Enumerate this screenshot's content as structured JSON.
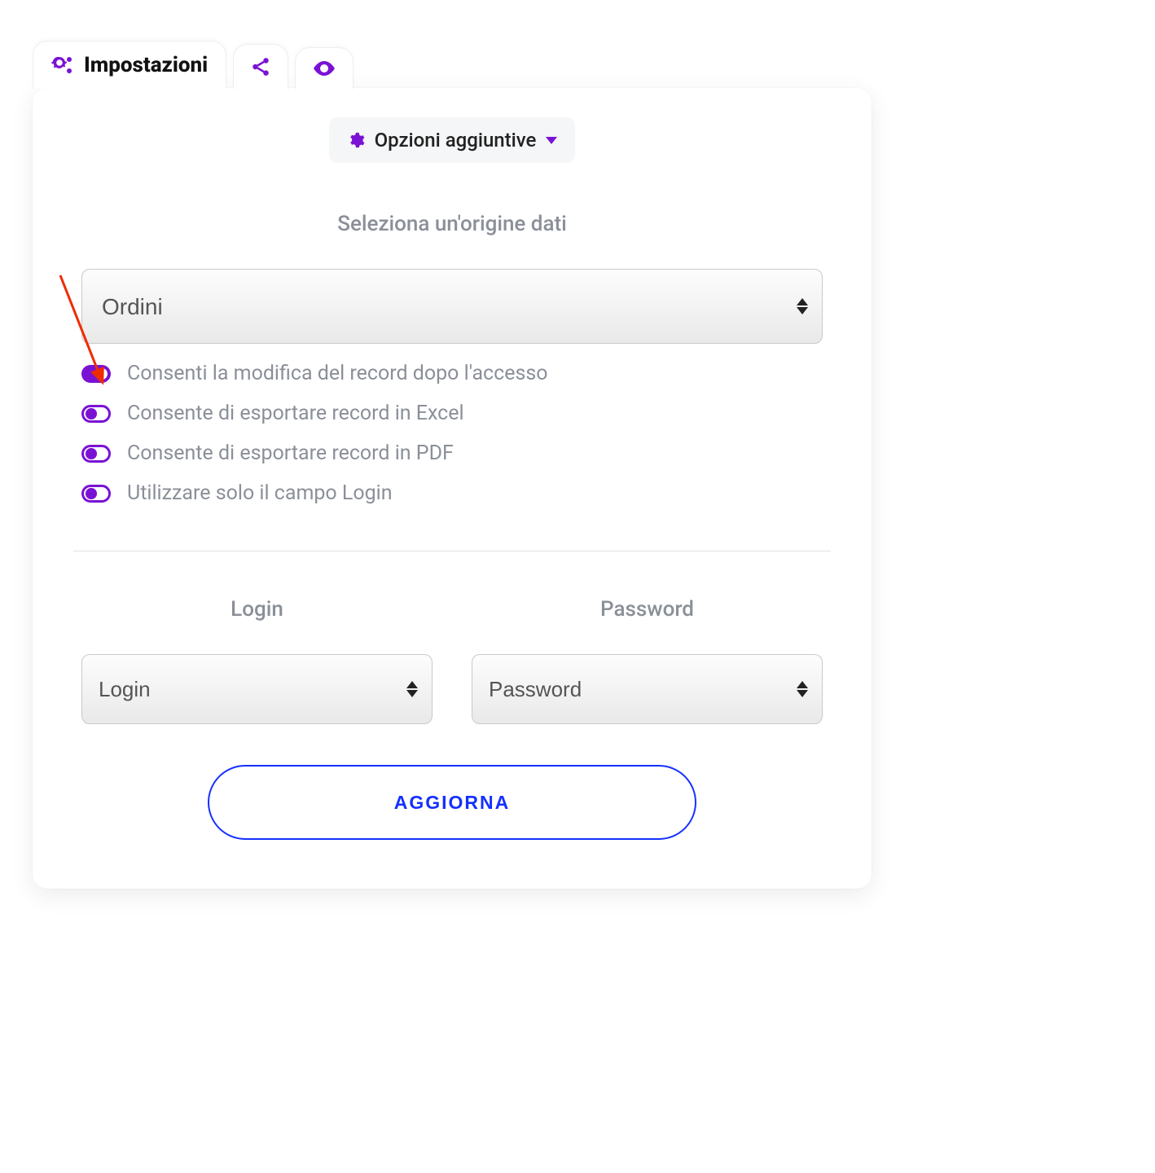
{
  "tabs": {
    "settings_label": "Impostazioni"
  },
  "options_menu": {
    "label": "Opzioni aggiuntive"
  },
  "data_source": {
    "heading": "Seleziona un'origine dati",
    "selected": "Ordini"
  },
  "toggles": [
    {
      "on": true,
      "label": "Consenti la modifica del record dopo l'accesso"
    },
    {
      "on": false,
      "label": "Consente di esportare record in Excel"
    },
    {
      "on": false,
      "label": "Consente di esportare record in PDF"
    },
    {
      "on": false,
      "label": "Utilizzare solo il campo Login"
    }
  ],
  "login_section": {
    "login_heading": "Login",
    "password_heading": "Password",
    "login_selected": "Login",
    "password_selected": "Password"
  },
  "buttons": {
    "update": "AGGIORNA"
  }
}
